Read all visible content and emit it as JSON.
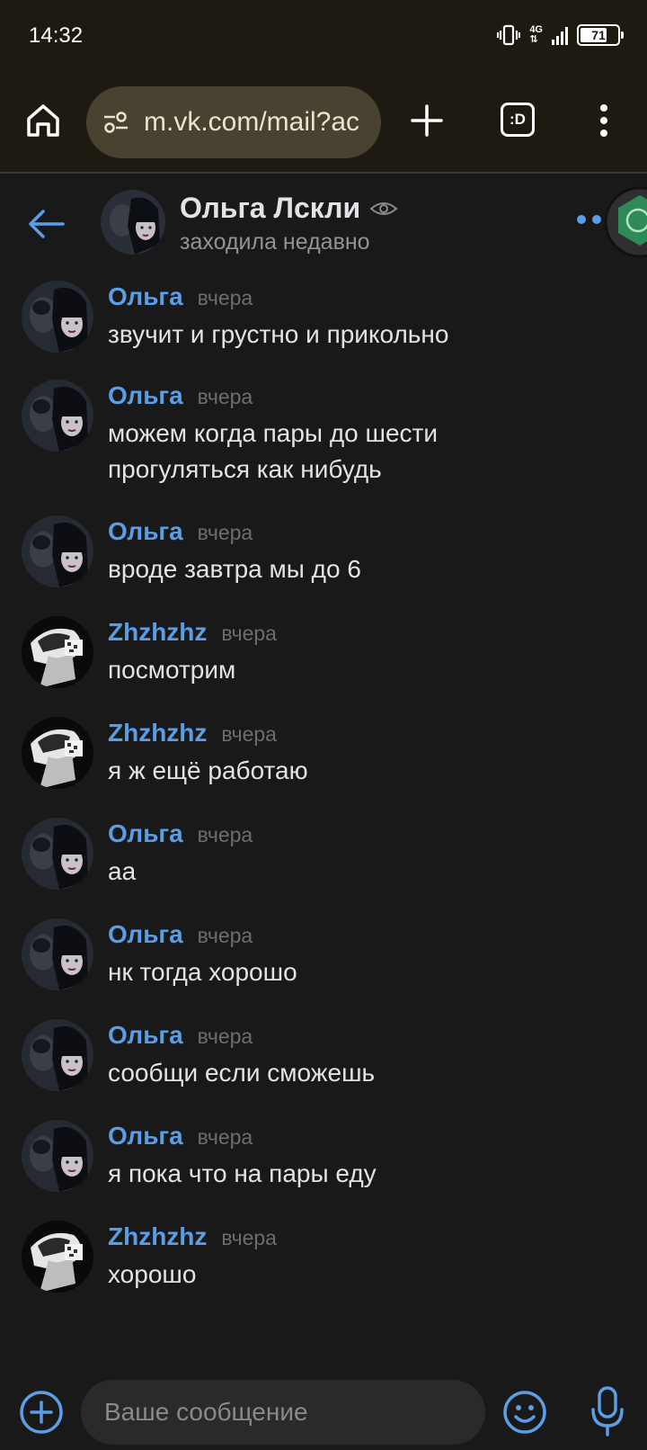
{
  "status_bar": {
    "time": "14:32",
    "network": "4G",
    "battery": "71"
  },
  "browser": {
    "url": "m.vk.com/mail?ac",
    "tabs_label": ":D"
  },
  "chat_header": {
    "name": "Ольга Лскли",
    "status": "заходила недавно"
  },
  "messages": [
    {
      "author": "Ольга",
      "time": "вчера",
      "text": "звучит и грустно и прикольно",
      "avatar": "olga"
    },
    {
      "author": "Ольга",
      "time": "вчера",
      "text": "можем когда пары до шести прогуляться как нибудь",
      "avatar": "olga"
    },
    {
      "author": "Ольга",
      "time": "вчера",
      "text": "вроде завтра мы до 6",
      "avatar": "olga"
    },
    {
      "author": "Zhzhzhz",
      "time": "вчера",
      "text": "посмотрим",
      "avatar": "zh"
    },
    {
      "author": "Zhzhzhz",
      "time": "вчера",
      "text": "я ж ещё работаю",
      "avatar": "zh"
    },
    {
      "author": "Ольга",
      "time": "вчера",
      "text": "аа",
      "avatar": "olga"
    },
    {
      "author": "Ольга",
      "time": "вчера",
      "text": "нк тогда хорошо",
      "avatar": "olga"
    },
    {
      "author": "Ольга",
      "time": "вчера",
      "text": "сообщи если сможешь",
      "avatar": "olga"
    },
    {
      "author": "Ольга",
      "time": "вчера",
      "text": "я пока что на пары еду",
      "avatar": "olga"
    },
    {
      "author": "Zhzhzhz",
      "time": "вчера",
      "text": "хорошо",
      "avatar": "zh"
    }
  ],
  "composer": {
    "placeholder": "Ваше сообщение"
  },
  "colors": {
    "background": "#19191a",
    "accent": "#5a9ee6",
    "browser_bar": "#1d1a12",
    "url_pill": "#4a4230"
  },
  "icons": [
    "vibrate-icon",
    "signal-icon",
    "battery-icon",
    "home-icon",
    "tune-icon",
    "plus-icon",
    "tabs-icon",
    "menu-dots-icon",
    "back-arrow-icon",
    "eye-icon",
    "more-dots-icon",
    "attach-plus-icon",
    "emoji-icon",
    "mic-icon"
  ]
}
